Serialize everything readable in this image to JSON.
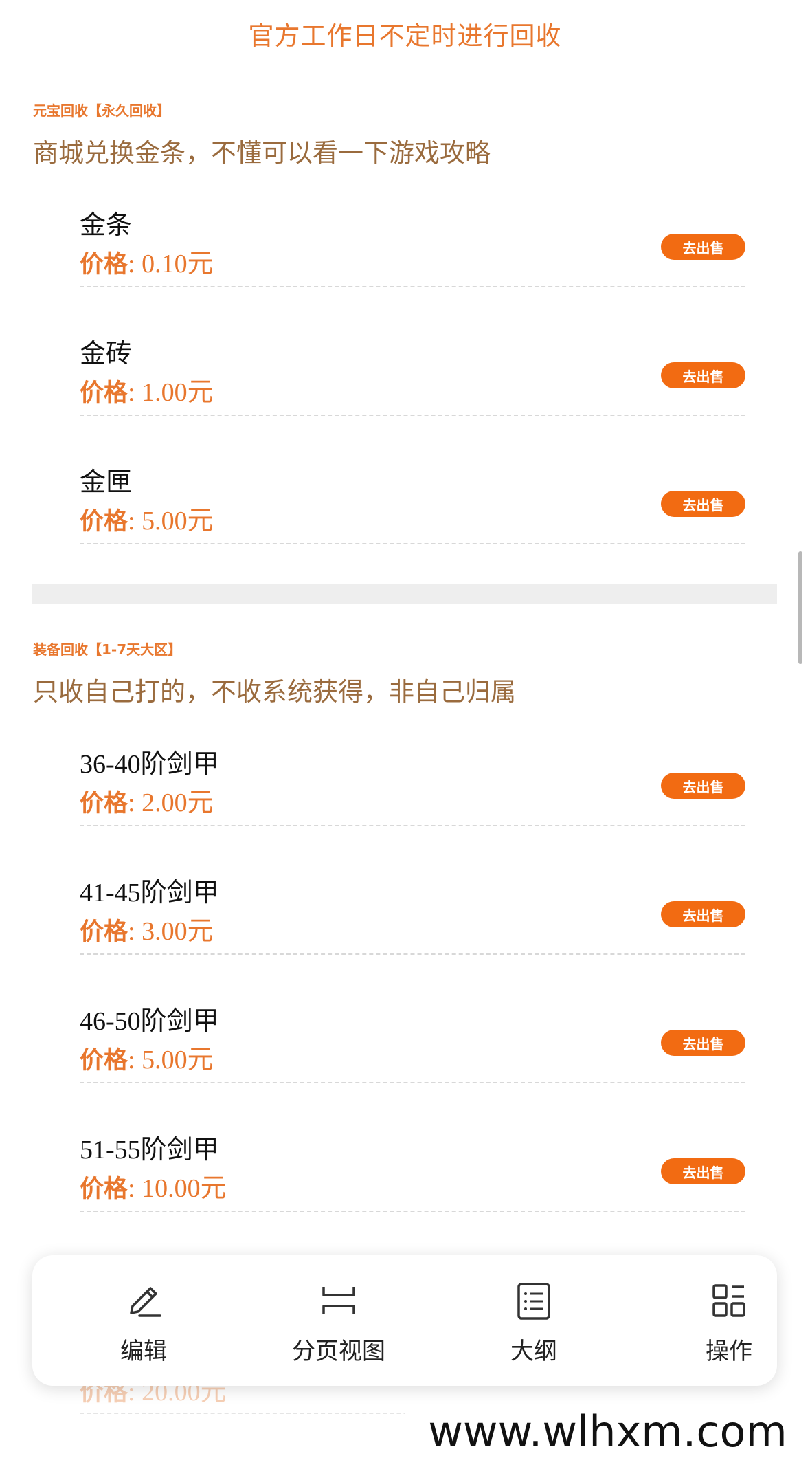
{
  "notice": "官方工作日不定时进行回收",
  "sections": [
    {
      "tag": "元宝回收【永久回收】",
      "desc": "商城兑换金条，不懂可以看一下游戏攻略",
      "items": [
        {
          "name": "金条",
          "price_label": "价格",
          "price": ": 0.10元",
          "button": "去出售"
        },
        {
          "name": "金砖",
          "price_label": "价格",
          "price": ": 1.00元",
          "button": "去出售"
        },
        {
          "name": "金匣",
          "price_label": "价格",
          "price": ": 5.00元",
          "button": "去出售"
        }
      ]
    },
    {
      "tag": "装备回收【1-7天大区】",
      "desc": "只收自己打的，不收系统获得，非自己归属",
      "items": [
        {
          "name": "36-40阶剑甲",
          "price_label": "价格",
          "price": ": 2.00元",
          "button": "去出售"
        },
        {
          "name": "41-45阶剑甲",
          "price_label": "价格",
          "price": ": 3.00元",
          "button": "去出售"
        },
        {
          "name": "46-50阶剑甲",
          "price_label": "价格",
          "price": ": 5.00元",
          "button": "去出售"
        },
        {
          "name": "51-55阶剑甲",
          "price_label": "价格",
          "price": ": 10.00元",
          "button": "去出售"
        }
      ]
    }
  ],
  "faded_item": {
    "price_label": "价格",
    "price": ": 20.00元"
  },
  "toolbar": {
    "edit": "编辑",
    "page_view": "分页视图",
    "outline": "大纲",
    "actions": "操作"
  },
  "watermark": "www.wlhxm.com",
  "colors": {
    "accent": "#e8772e",
    "button": "#f26b12",
    "desc": "#9a6b3e"
  }
}
